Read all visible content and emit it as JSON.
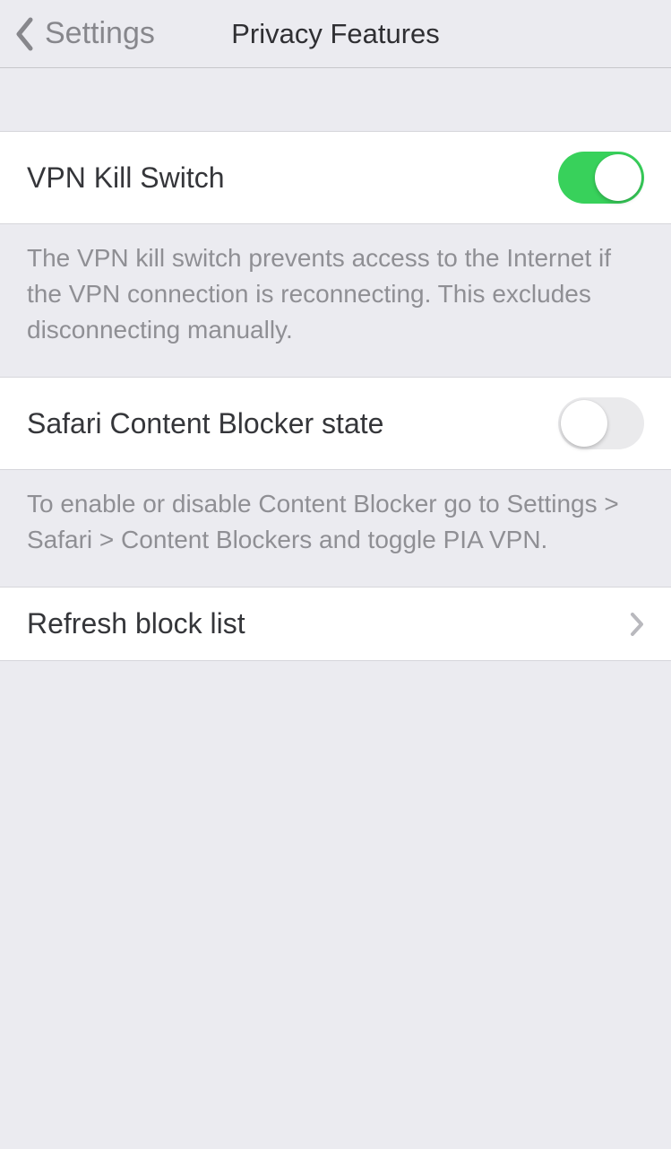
{
  "nav": {
    "back_label": "Settings",
    "title": "Privacy Features"
  },
  "sections": {
    "kill_switch": {
      "title": "VPN Kill Switch",
      "enabled": true,
      "footer": "The VPN kill switch prevents access to the Internet if the VPN connection is reconnecting. This excludes disconnecting manually."
    },
    "content_blocker": {
      "title": "Safari Content Blocker state",
      "enabled": false,
      "footer": "To enable or disable Content Blocker go to Settings > Safari > Content Blockers and toggle PIA VPN."
    },
    "refresh": {
      "title": "Refresh block list"
    }
  },
  "colors": {
    "accent_on": "#38d15b",
    "background": "#ebebf0",
    "row_bg": "#ffffff",
    "text_primary": "#35363a",
    "text_secondary": "#8f8f94"
  }
}
